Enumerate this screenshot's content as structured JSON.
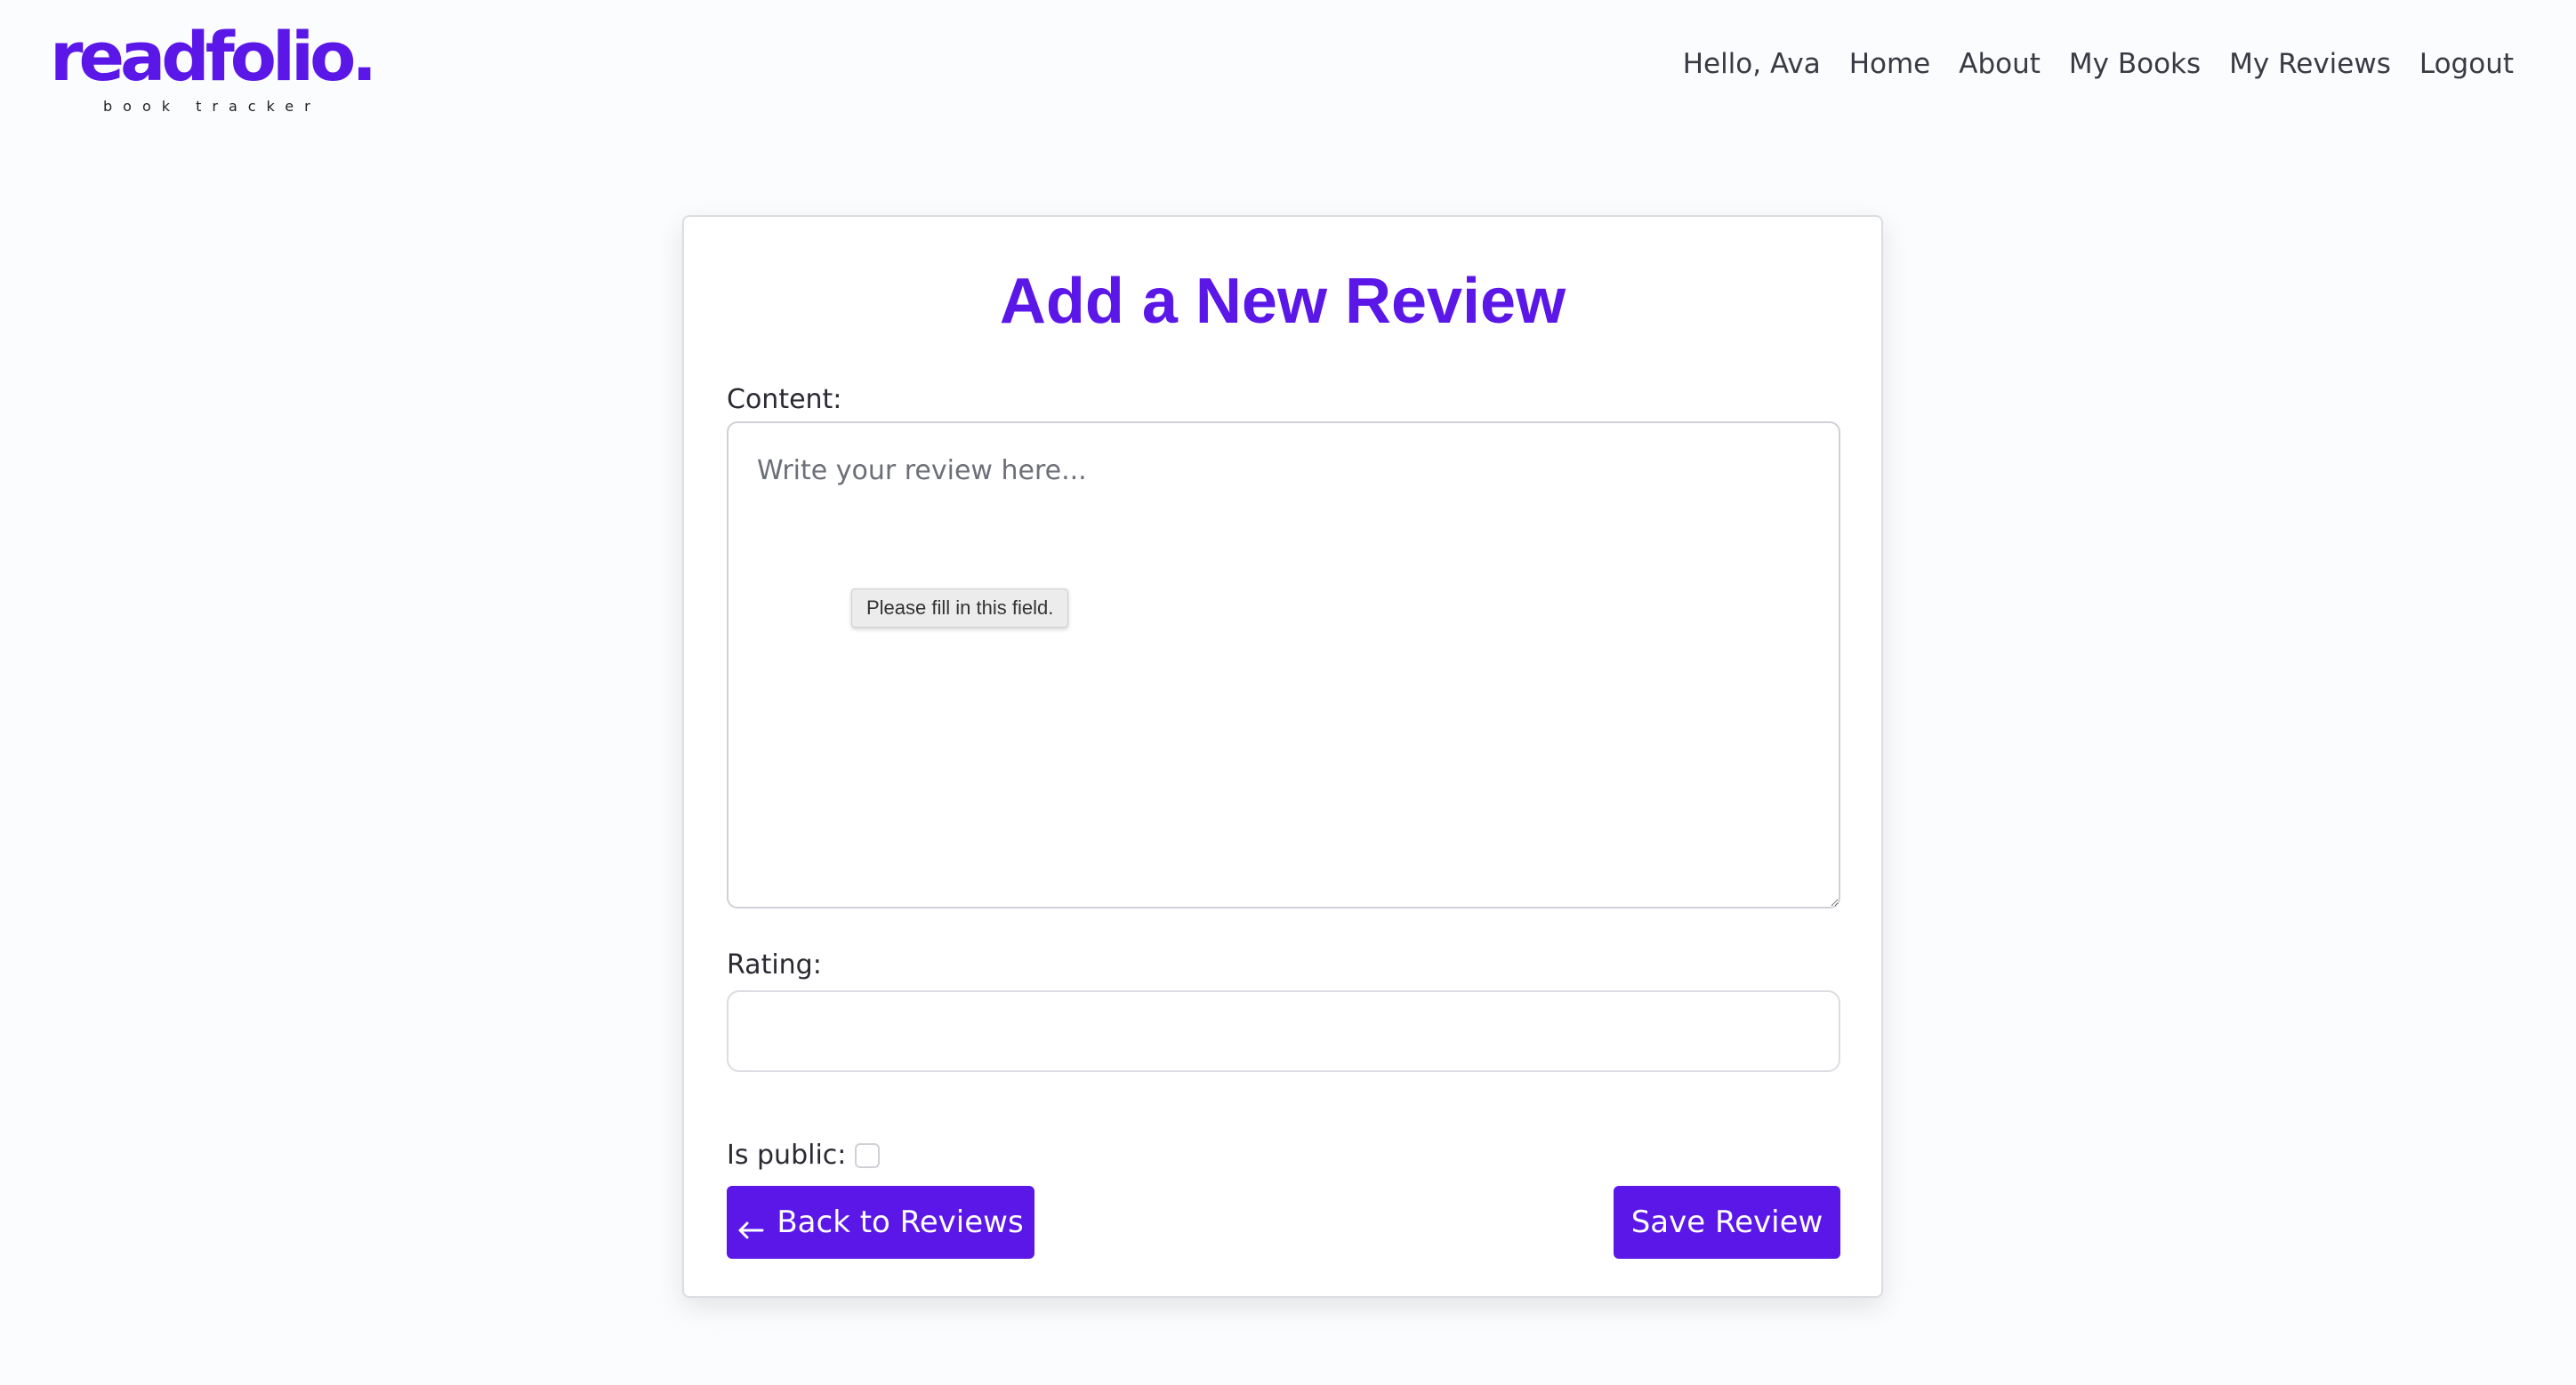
{
  "brand": {
    "name": "readfolio.",
    "tagline": "book tracker"
  },
  "nav": {
    "greeting": "Hello, Ava",
    "items": [
      {
        "label": "Home"
      },
      {
        "label": "About"
      },
      {
        "label": "My Books"
      },
      {
        "label": "My Reviews"
      },
      {
        "label": "Logout"
      }
    ]
  },
  "form": {
    "title": "Add a New Review",
    "content_label": "Content:",
    "content_placeholder": "Write your review here...",
    "content_value": "",
    "validation_tooltip": "Please fill in this field.",
    "rating_label": "Rating:",
    "rating_value": "",
    "public_label": "Is public:",
    "public_checked": false,
    "back_button": "Back to Reviews",
    "save_button": "Save Review"
  },
  "icons": {
    "back": "arrow-left-icon"
  },
  "colors": {
    "accent": "#5a17e8",
    "background": "#fbfcfe"
  }
}
